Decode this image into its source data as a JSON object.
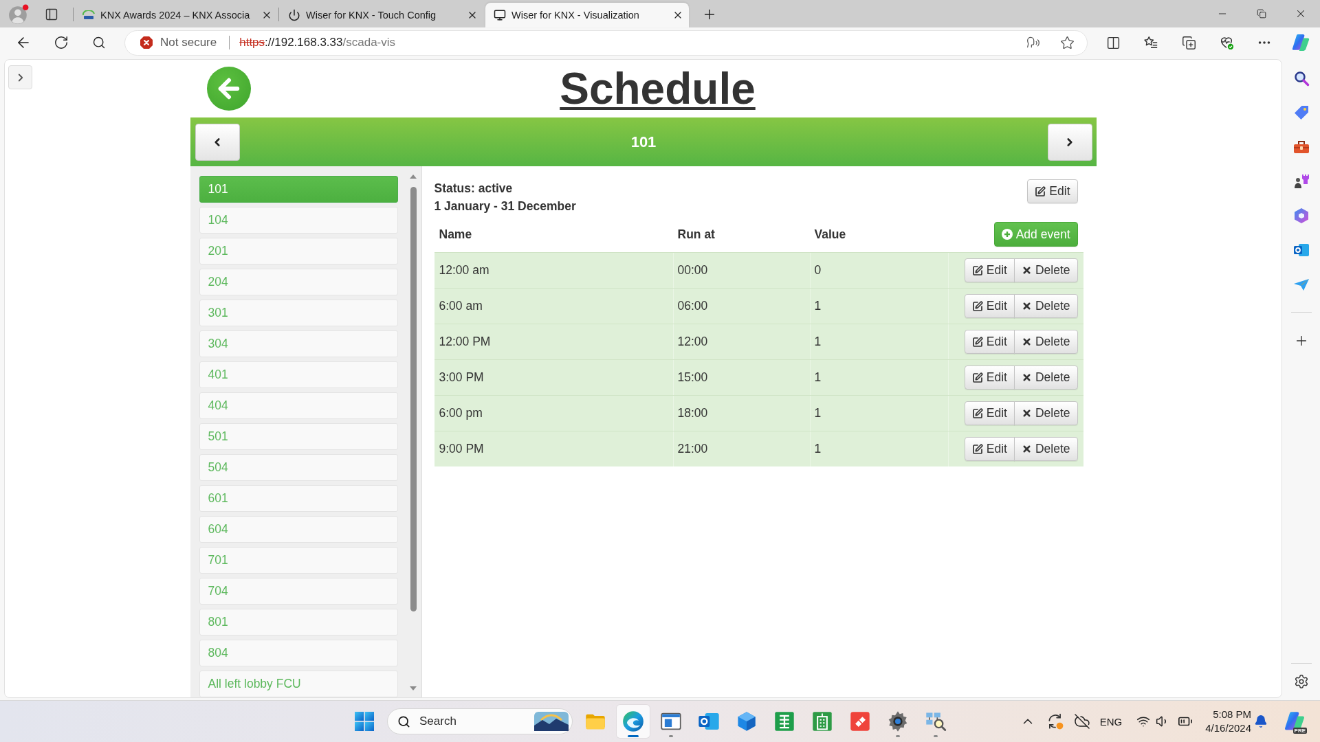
{
  "browser": {
    "tabs": [
      {
        "title": "KNX Awards 2024 – KNX Associa",
        "selected": false
      },
      {
        "title": "Wiser for KNX - Touch Config",
        "selected": false
      },
      {
        "title": "Wiser for KNX - Visualization",
        "selected": true
      }
    ],
    "address": {
      "security": "Not secure",
      "scheme": "https",
      "host": "://192.168.3.33",
      "path": "/scada-vis"
    }
  },
  "page": {
    "title": "Schedule",
    "current": "101",
    "schedules": [
      {
        "label": "101",
        "selected": true
      },
      {
        "label": "104",
        "selected": false
      },
      {
        "label": "201",
        "selected": false
      },
      {
        "label": "204",
        "selected": false
      },
      {
        "label": "301",
        "selected": false
      },
      {
        "label": "304",
        "selected": false
      },
      {
        "label": "401",
        "selected": false
      },
      {
        "label": "404",
        "selected": false
      },
      {
        "label": "501",
        "selected": false
      },
      {
        "label": "504",
        "selected": false
      },
      {
        "label": "601",
        "selected": false
      },
      {
        "label": "604",
        "selected": false
      },
      {
        "label": "701",
        "selected": false
      },
      {
        "label": "704",
        "selected": false
      },
      {
        "label": "801",
        "selected": false
      },
      {
        "label": "804",
        "selected": false
      },
      {
        "label": "All left lobby FCU",
        "selected": false
      }
    ],
    "details": {
      "status": "Status: active",
      "period": "1 January - 31 December",
      "edit": "Edit"
    },
    "table": {
      "columns": [
        "Name",
        "Run at",
        "Value"
      ],
      "add_event": "Add event",
      "rows": [
        {
          "name": "12:00 am",
          "run_at": "00:00",
          "value": "0",
          "edit": "Edit",
          "delete": "Delete"
        },
        {
          "name": "6:00 am",
          "run_at": "06:00",
          "value": "1",
          "edit": "Edit",
          "delete": "Delete"
        },
        {
          "name": "12:00 PM",
          "run_at": "12:00",
          "value": "1",
          "edit": "Edit",
          "delete": "Delete"
        },
        {
          "name": "3:00 PM",
          "run_at": "15:00",
          "value": "1",
          "edit": "Edit",
          "delete": "Delete"
        },
        {
          "name": "6:00 pm",
          "run_at": "18:00",
          "value": "1",
          "edit": "Edit",
          "delete": "Delete"
        },
        {
          "name": "9:00 PM",
          "run_at": "21:00",
          "value": "1",
          "edit": "Edit",
          "delete": "Delete"
        }
      ]
    }
  },
  "taskbar": {
    "search": {
      "placeholder": "Search"
    },
    "apps": [
      {
        "selected": false,
        "running": false
      },
      {
        "selected": true,
        "running": true
      },
      {
        "selected": false,
        "running": true
      },
      {
        "selected": false,
        "running": false
      },
      {
        "selected": false,
        "running": false
      },
      {
        "selected": false,
        "running": false
      },
      {
        "selected": false,
        "running": false
      },
      {
        "selected": false,
        "running": false
      },
      {
        "selected": false,
        "running": true
      },
      {
        "selected": false,
        "running": true
      }
    ],
    "language": "ENG",
    "time": "5:08 PM",
    "date": "4/16/2024",
    "copilot_badge": "PRE"
  }
}
